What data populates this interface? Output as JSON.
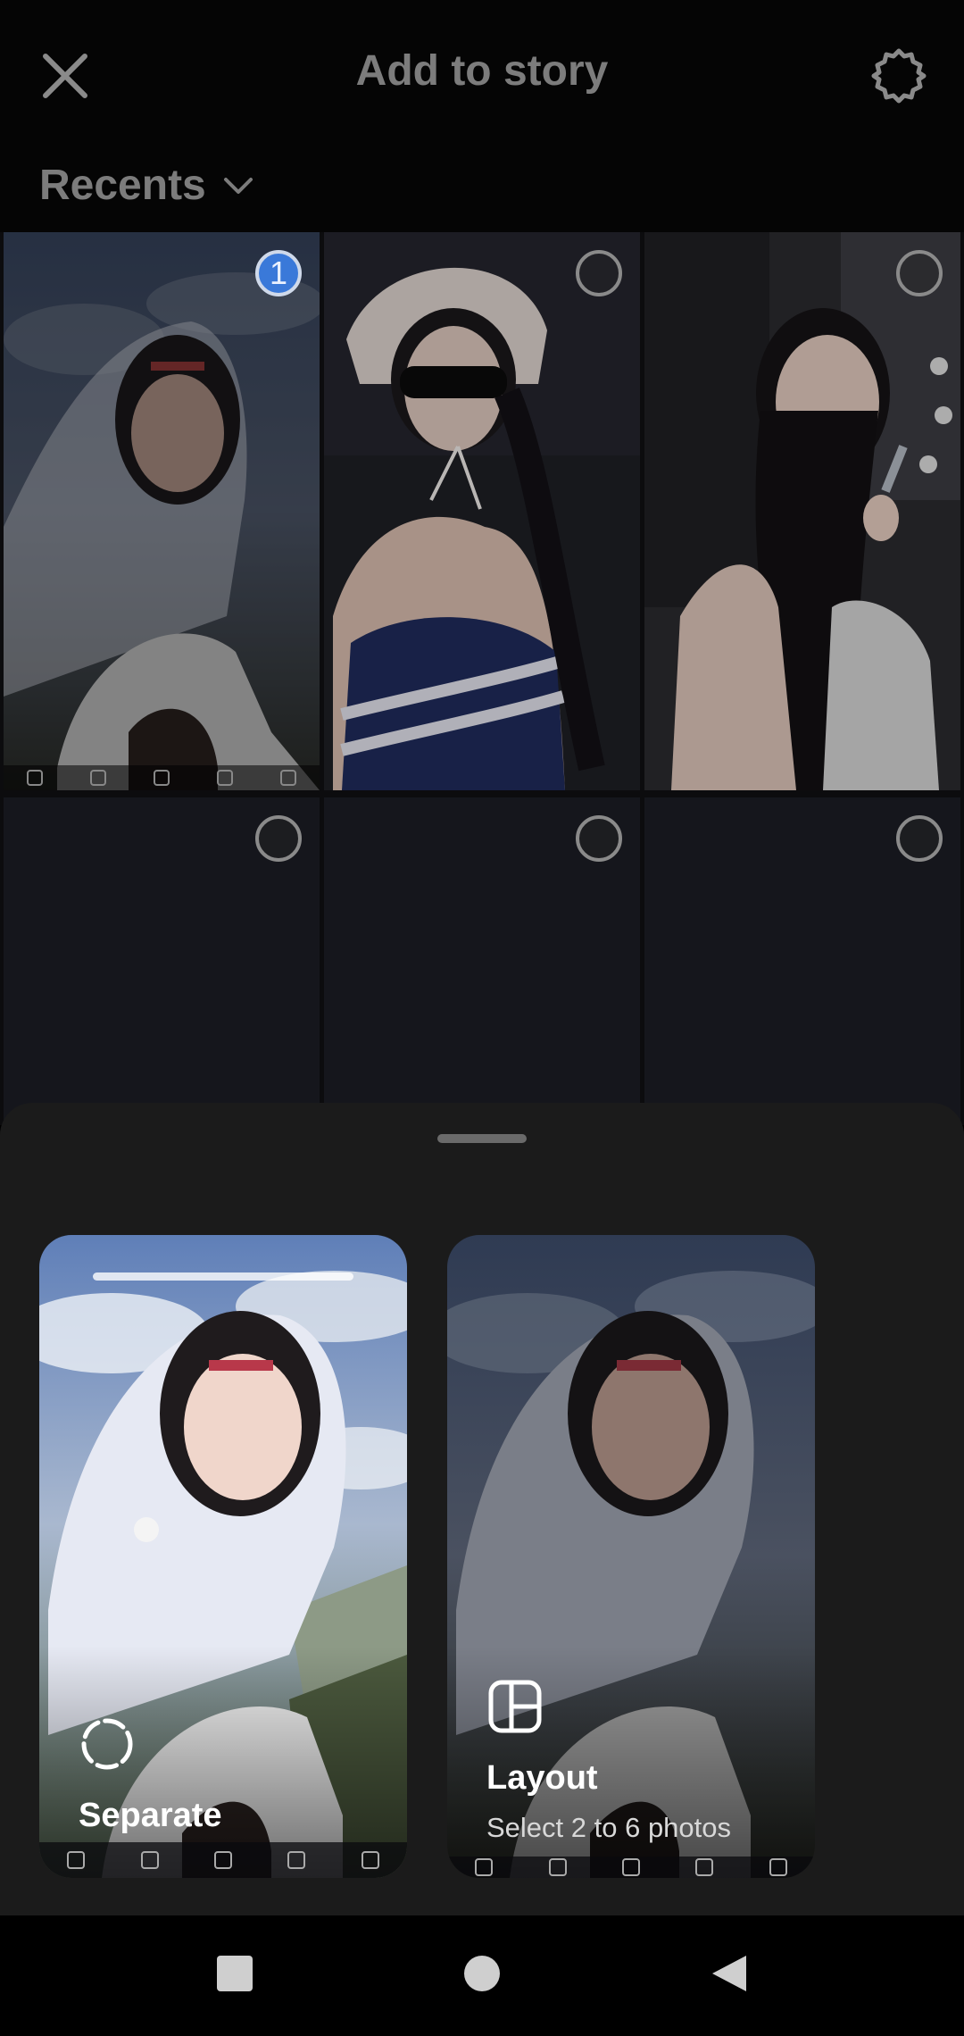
{
  "header": {
    "title": "Add to story",
    "close_icon": "close-icon",
    "settings_icon": "settings-gear-icon"
  },
  "album": {
    "label": "Recents",
    "chevron_icon": "chevron-down-icon"
  },
  "grid": {
    "cells": [
      {
        "kind": "photo",
        "selected": true,
        "selection_number": "1",
        "scene": "girl-fur-hood-sky"
      },
      {
        "kind": "photo",
        "selected": false,
        "selection_number": "",
        "scene": "girl-headscarf-sunglasses"
      },
      {
        "kind": "photo",
        "selected": false,
        "selection_number": "",
        "scene": "girl-wink-makeup-brush"
      },
      {
        "kind": "blank",
        "selected": false,
        "selection_number": ""
      },
      {
        "kind": "blank",
        "selected": false,
        "selection_number": ""
      },
      {
        "kind": "blank",
        "selected": false,
        "selection_number": ""
      }
    ]
  },
  "sheet": {
    "options": [
      {
        "label": "Separate",
        "sub": "",
        "icon": "loading-dashed-circle-icon"
      },
      {
        "label": "Layout",
        "sub": "Select 2 to 6 photos",
        "icon": "layout-grid-icon"
      }
    ]
  },
  "system_nav": {
    "recents_icon": "square-icon",
    "home_icon": "circle-icon",
    "back_icon": "triangle-back-icon"
  },
  "colors": {
    "selection_blue": "#3a79d9",
    "sheet_bg": "#1b1b1b",
    "header_text": "#7c7c7c"
  }
}
